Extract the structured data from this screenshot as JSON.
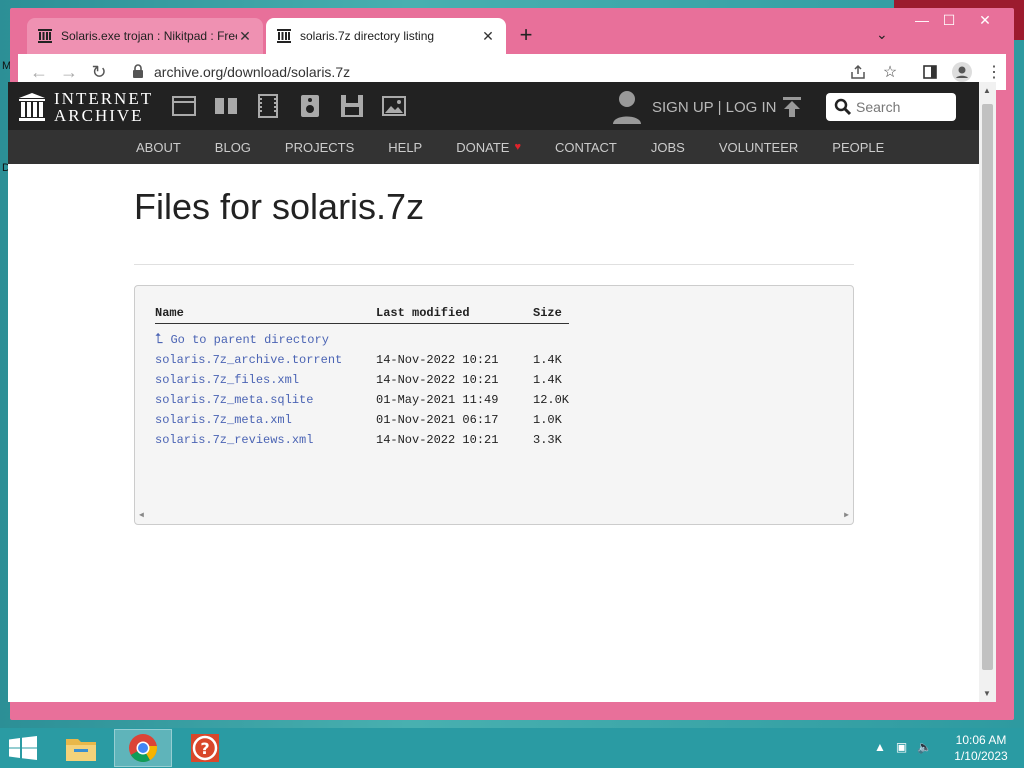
{
  "desktop": {
    "letters": [
      "M",
      "D"
    ]
  },
  "browser": {
    "tabs": [
      {
        "title": "Solaris.exe trojan : Nikitpad : Free",
        "active": false
      },
      {
        "title": "solaris.7z directory listing",
        "active": true
      }
    ],
    "window_controls": {
      "minimize": "—",
      "maximize": "☐",
      "close": "✕"
    },
    "address": "archive.org/download/solaris.7z",
    "accent": "#e8709a"
  },
  "ia": {
    "logo_line1": "INTERNET",
    "logo_line2": "ARCHIVE",
    "media_icons": [
      "web-icon",
      "texts-icon",
      "video-icon",
      "audio-icon",
      "software-icon",
      "images-icon"
    ],
    "signup": "SIGN UP | LOG IN",
    "search_placeholder": "Search",
    "nav": [
      "ABOUT",
      "BLOG",
      "PROJECTS",
      "HELP",
      "DONATE",
      "CONTACT",
      "JOBS",
      "VOLUNTEER",
      "PEOPLE"
    ],
    "donate_heart": "♥"
  },
  "page": {
    "title": "Files for solaris.7z",
    "columns": [
      "Name",
      "Last modified",
      "Size"
    ],
    "parent_link": "Go to parent directory",
    "files": [
      {
        "name": "solaris.7z_archive.torrent",
        "modified": "14-Nov-2022 10:21",
        "size": "1.4K"
      },
      {
        "name": "solaris.7z_files.xml",
        "modified": "14-Nov-2022 10:21",
        "size": "1.4K"
      },
      {
        "name": "solaris.7z_meta.sqlite",
        "modified": "01-May-2021 11:49",
        "size": "12.0K"
      },
      {
        "name": "solaris.7z_meta.xml",
        "modified": "01-Nov-2021 06:17",
        "size": "1.0K"
      },
      {
        "name": "solaris.7z_reviews.xml",
        "modified": "14-Nov-2022 10:21",
        "size": "3.3K"
      }
    ]
  },
  "taskbar": {
    "apps": [
      "file-explorer-icon",
      "chrome-icon",
      "help-app-icon"
    ],
    "time": "10:06 AM",
    "date": "1/10/2023"
  }
}
